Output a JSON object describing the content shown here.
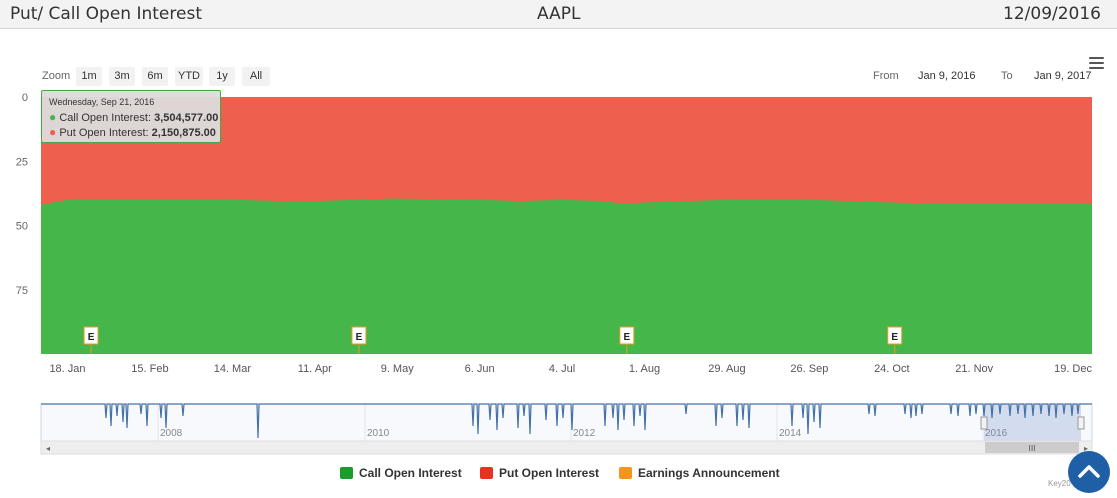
{
  "header": {
    "title": "Put/ Call Open Interest",
    "symbol": "AAPL",
    "date": "12/09/2016"
  },
  "range_selector": {
    "zoom_label": "Zoom",
    "buttons": [
      "1m",
      "3m",
      "6m",
      "YTD",
      "1y",
      "All"
    ],
    "from_label": "From",
    "from_value": "Jan 9, 2016",
    "to_label": "To",
    "to_value": "Jan 9, 2017"
  },
  "tooltip": {
    "date": "Wednesday, Sep 21, 2016",
    "call_label": "Call Open Interest:",
    "call_value": "3,504,577.00",
    "put_label": "Put Open Interest:",
    "put_value": "2,150,875.00"
  },
  "legend": {
    "call": "Call Open Interest",
    "put": "Put Open Interest",
    "earnings": "Earnings Announcement"
  },
  "colors": {
    "call": "#45b649",
    "put": "#ee5f4d",
    "earnings": "#f7941d",
    "navigator_line": "#4572a7",
    "scroll_top_button": "#1f5fa6"
  },
  "icons": {
    "menu": "hamburger-menu-icon",
    "scroll_top": "chevron-up-icon"
  },
  "credit": "Key20",
  "chart_data": {
    "type": "area",
    "stacking": "percent",
    "y_ticks": [
      "0",
      "25",
      "50",
      "75"
    ],
    "ylim": [
      0,
      100
    ],
    "x_ticks": [
      "18. Jan",
      "15. Feb",
      "14. Mar",
      "11. Apr",
      "9. May",
      "6. Jun",
      "4. Jul",
      "1. Aug",
      "29. Aug",
      "26. Sep",
      "24. Oct",
      "21. Nov",
      "19. Dec"
    ],
    "x": [
      "2016-01-09",
      "2016-01-18",
      "2016-02-01",
      "2016-02-15",
      "2016-03-01",
      "2016-03-14",
      "2016-04-01",
      "2016-04-11",
      "2016-04-25",
      "2016-05-09",
      "2016-05-23",
      "2016-06-06",
      "2016-06-20",
      "2016-07-04",
      "2016-07-18",
      "2016-07-25",
      "2016-08-01",
      "2016-08-15",
      "2016-08-29",
      "2016-09-12",
      "2016-09-26",
      "2016-10-10",
      "2016-10-24",
      "2016-11-07",
      "2016-11-21",
      "2016-12-05",
      "2016-12-19",
      "2016-12-31"
    ],
    "series": [
      {
        "name": "Call Open Interest",
        "values": [
          58,
          60,
          60,
          60,
          60,
          60,
          59.5,
          59.5,
          60,
          60.5,
          60,
          60,
          59.5,
          60,
          59.5,
          58.5,
          59,
          59.5,
          60,
          60,
          60,
          59.5,
          59,
          58.5,
          58.5,
          58.5,
          58.5,
          58.5
        ]
      },
      {
        "name": "Put Open Interest",
        "values": [
          42,
          40,
          40,
          40,
          40,
          40,
          40.5,
          40.5,
          40,
          39.5,
          40,
          40,
          40.5,
          40,
          40.5,
          41.5,
          41,
          40.5,
          40,
          40,
          40,
          40.5,
          41,
          41.5,
          41.5,
          41.5,
          41.5,
          41.5
        ]
      }
    ],
    "earnings_markers": [
      {
        "label": "E",
        "date": "2016-01-26"
      },
      {
        "label": "E",
        "date": "2016-04-26"
      },
      {
        "label": "E",
        "date": "2016-07-26"
      },
      {
        "label": "E",
        "date": "2016-10-25"
      }
    ],
    "navigator": {
      "x_ticks": [
        "2008",
        "2010",
        "2012",
        "2014",
        "2016"
      ],
      "selected_range": [
        "2016-01-09",
        "2017-01-09"
      ]
    },
    "legend_position": "bottom-center"
  }
}
